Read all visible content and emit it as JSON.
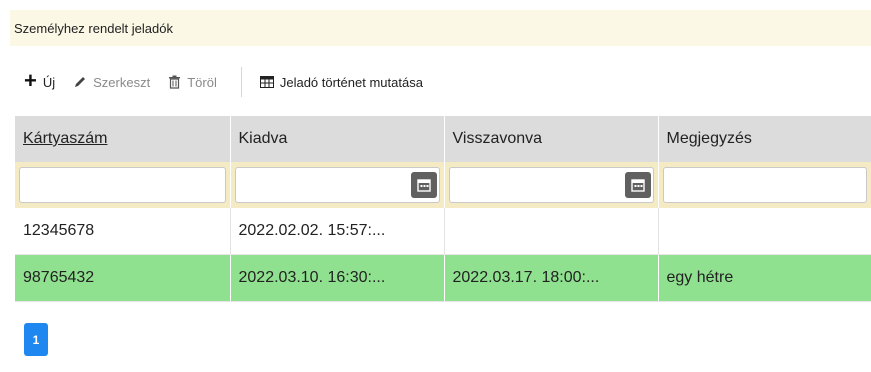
{
  "panel": {
    "title": "Személyhez rendelt jeladók"
  },
  "toolbar": {
    "new_label": "Új",
    "edit_label": "Szerkeszt",
    "delete_label": "Töröl",
    "history_label": "Jeladó történet mutatása"
  },
  "grid": {
    "columns": [
      "Kártyaszám",
      "Kiadva",
      "Visszavonva",
      "Megjegyzés"
    ],
    "rows": [
      {
        "card": "12345678",
        "issued": "2022.02.02. 15:57:...",
        "revoked": "",
        "note": ""
      },
      {
        "card": "98765432",
        "issued": "2022.03.10. 16:30:...",
        "revoked": "2022.03.17. 18:00:...",
        "note": "egy hétre"
      }
    ],
    "selected_row_color": "#8fe08f"
  },
  "pager": {
    "current_page": "1",
    "accent": "#1e88f0"
  },
  "icons": {
    "new": "plus-icon",
    "edit": "pencil-icon",
    "delete": "trash-icon",
    "history": "table-icon",
    "date_picker": "calendar-icon"
  }
}
